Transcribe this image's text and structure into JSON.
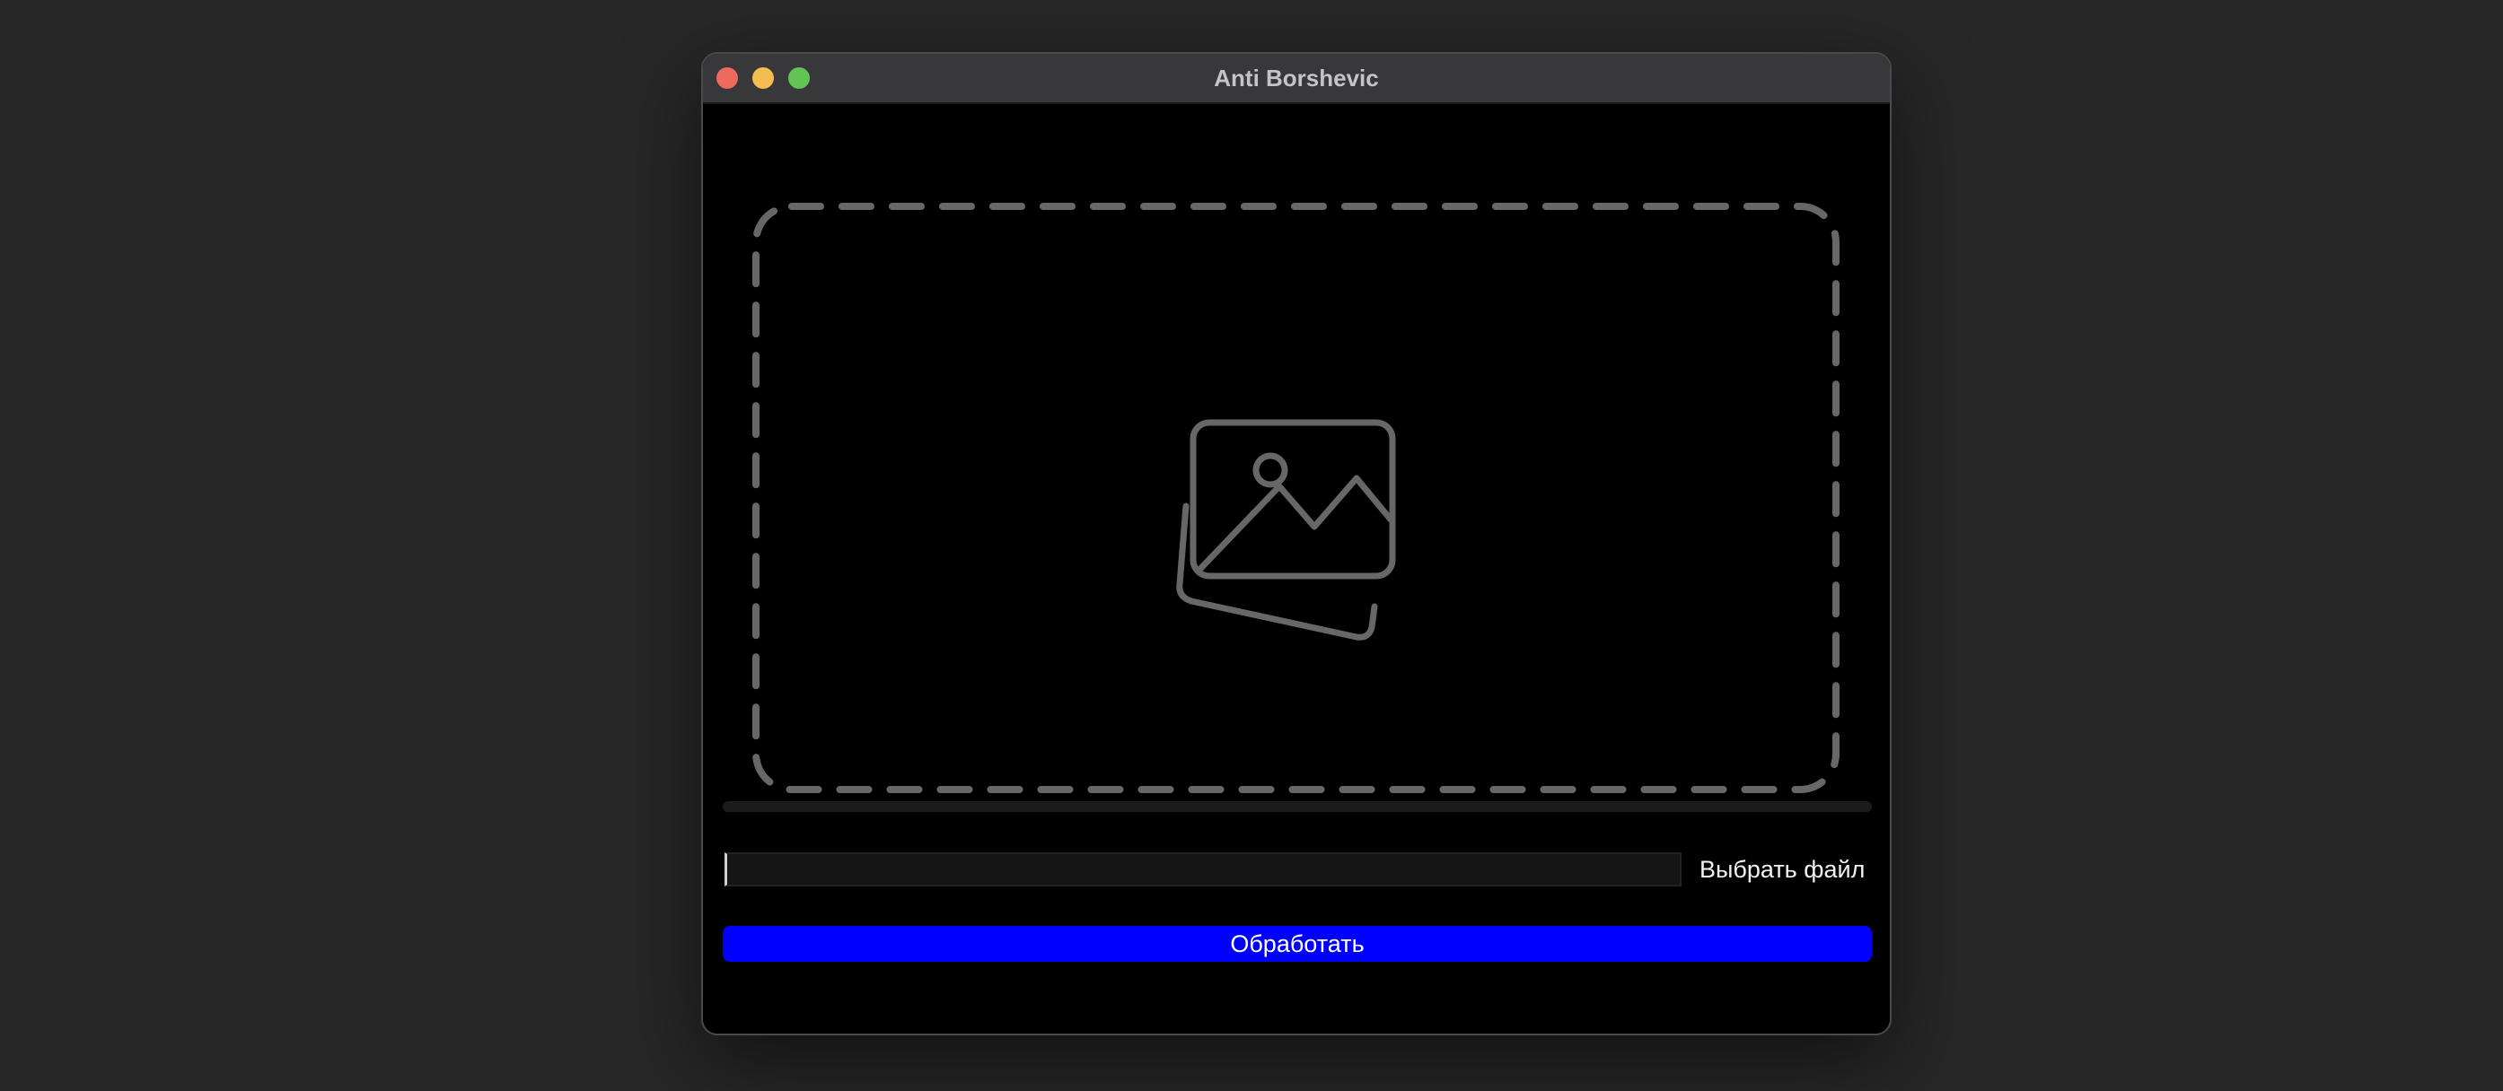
{
  "window": {
    "title": "Anti Borshevic"
  },
  "dropzone": {
    "icon": "images-placeholder-icon",
    "border_color": "#676767"
  },
  "progress": {
    "value": 0
  },
  "file_input": {
    "value": "",
    "placeholder": ""
  },
  "buttons": {
    "choose_file_label": "Выбрать файл",
    "process_label": "Обработать"
  },
  "colors": {
    "accent": "#0000ff",
    "background": "#000000",
    "desktop": "#272727"
  }
}
